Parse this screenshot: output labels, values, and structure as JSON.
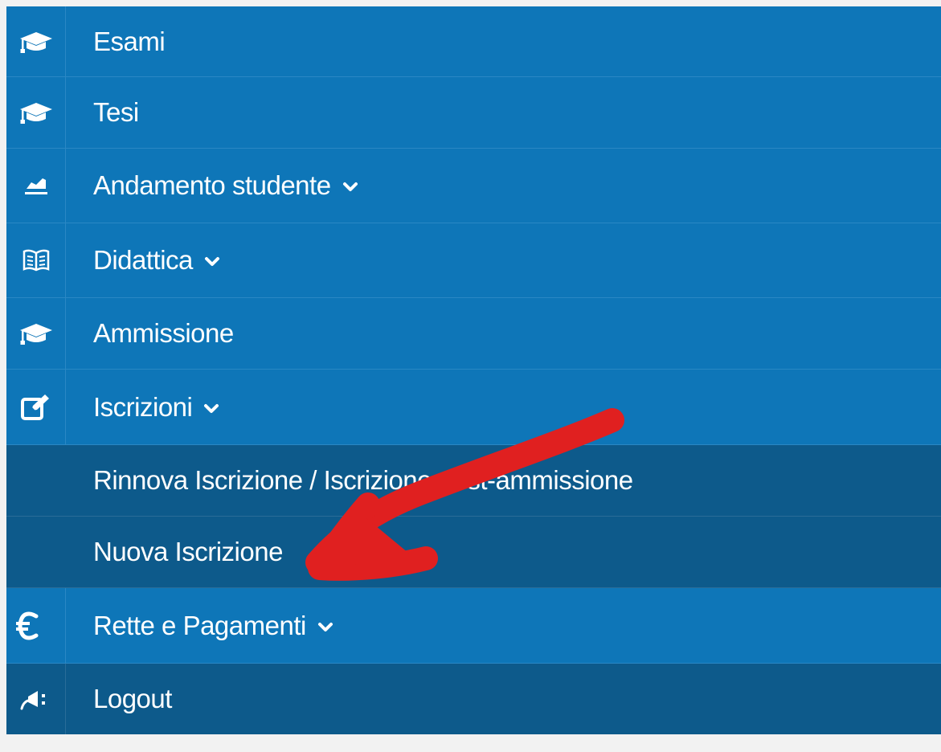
{
  "menu": {
    "items": [
      {
        "label": "Esami",
        "icon": "graduation-cap-icon"
      },
      {
        "label": "Tesi",
        "icon": "graduation-cap-icon"
      },
      {
        "label": "Andamento studente",
        "icon": "area-chart-icon",
        "expandable": true
      },
      {
        "label": "Didattica",
        "icon": "book-icon",
        "expandable": true
      },
      {
        "label": "Ammissione",
        "icon": "graduation-cap-icon"
      },
      {
        "label": "Iscrizioni",
        "icon": "edit-icon",
        "expandable": true,
        "expanded": true
      },
      {
        "label": "Rinnova Iscrizione / Iscrizione post-ammissione",
        "submenu": true
      },
      {
        "label": "Nuova Iscrizione",
        "submenu": true
      },
      {
        "label": "Rette e Pagamenti",
        "icon": "euro-icon",
        "expandable": true
      },
      {
        "label": "Logout",
        "icon": "logout-plug-icon"
      }
    ]
  },
  "annotation": {
    "color": "#e02020",
    "type": "hand-drawn-arrow"
  },
  "colors": {
    "menu_bg": "#0e76b8",
    "submenu_bg": "#0d5a8b",
    "text": "#ffffff"
  }
}
